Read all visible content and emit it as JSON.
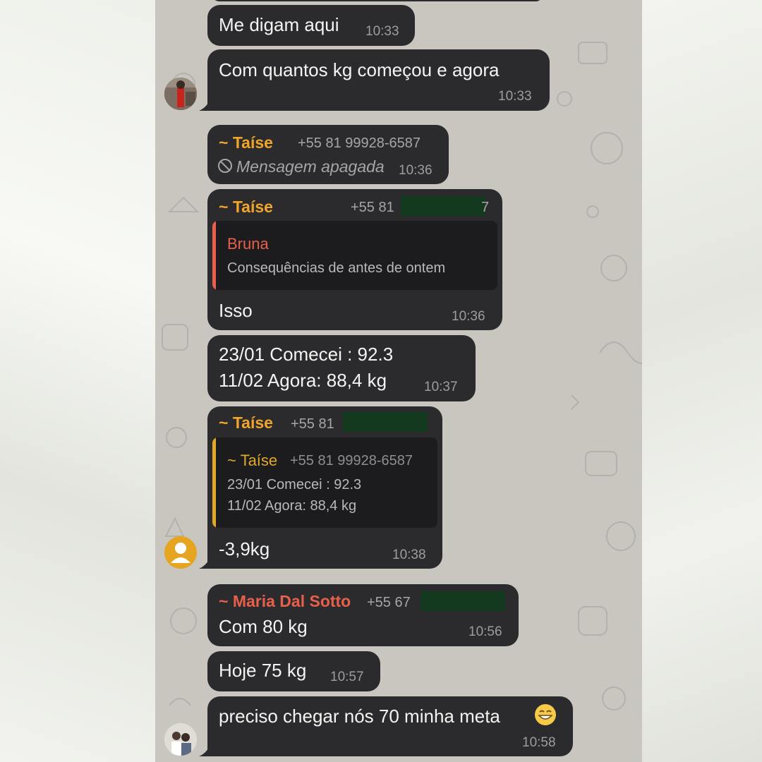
{
  "colors": {
    "bubble": "#2b2b2d",
    "sender_taise": "#f0a52a",
    "sender_maria": "#e8604c",
    "quote_bruna": "#e8604c",
    "quote_taise": "#e0a928",
    "redaction": "#13391f"
  },
  "messages": {
    "m1": {
      "text": "Me digam aqui",
      "time": "10:33"
    },
    "m2": {
      "text": "Com quantos kg começou e agora",
      "time": "10:33"
    },
    "m3": {
      "sender": "~ Taíse",
      "phone": "+55 81 99928-6587",
      "deleted_text": "Mensagem apagada",
      "time": "10:36",
      "icon": "prohibited-icon"
    },
    "m4": {
      "sender": "~ Taíse",
      "phone": "+55 81",
      "phone_tail": "7",
      "quote_name": "Bruna",
      "quote_text": "Consequências de antes de ontem",
      "text": "Isso",
      "time": "10:36"
    },
    "m5": {
      "line1": "23/01 Comecei : 92.3",
      "line2": "11/02 Agora: 88,4 kg",
      "time": "10:37"
    },
    "m6": {
      "sender": "~ Taíse",
      "phone": "+55 81",
      "quote_name": "~ Taíse",
      "quote_phone": "+55 81 99928-6587",
      "quote_line1": "23/01 Comecei : 92.3",
      "quote_line2": "11/02 Agora: 88,4 kg",
      "text": "-3,9kg",
      "time": "10:38",
      "avatar": "default-user-icon"
    },
    "m7": {
      "sender": "~ Maria Dal Sotto",
      "phone": "+55 67",
      "text": "Com 80 kg",
      "time": "10:56"
    },
    "m8": {
      "text": "Hoje 75 kg",
      "time": "10:57"
    },
    "m9": {
      "text": "preciso chegar nós 70 minha meta",
      "emoji": "😁",
      "time": "10:58"
    }
  }
}
